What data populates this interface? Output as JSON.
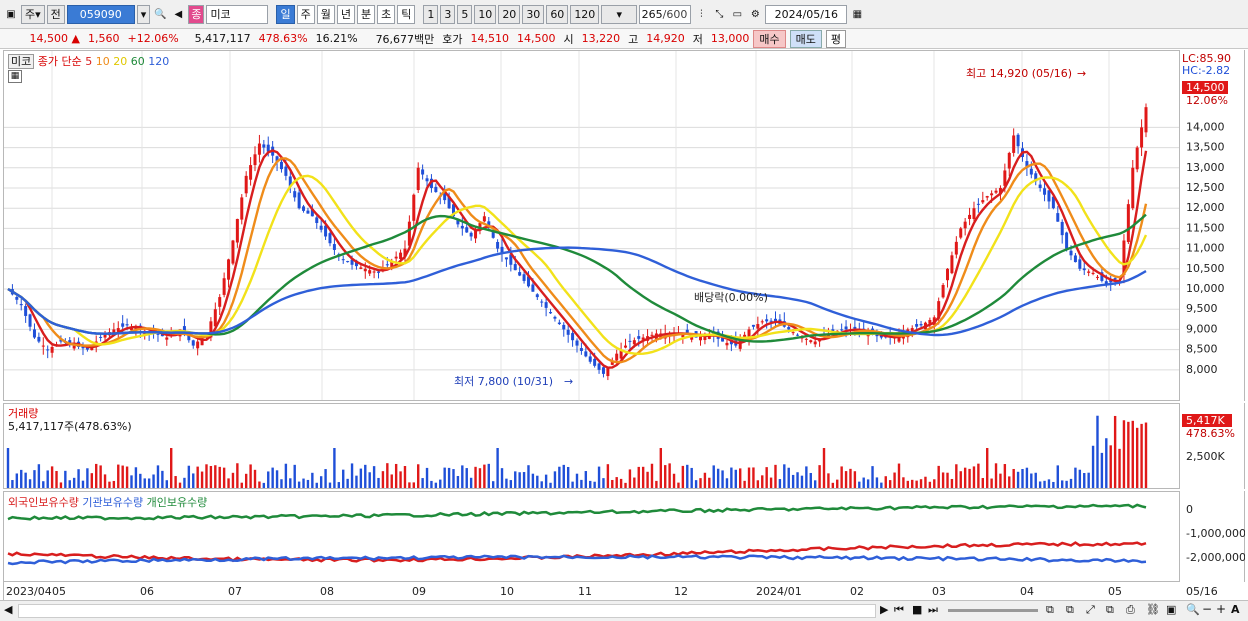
{
  "toolbar": {
    "market_btn": "주",
    "prev_btn": "전",
    "code": "059090",
    "name": "미코",
    "name_badge": "종",
    "periods": [
      "일",
      "주",
      "월",
      "년",
      "분",
      "초",
      "틱"
    ],
    "numbers": [
      "1",
      "3",
      "5",
      "10",
      "20",
      "30",
      "60",
      "120"
    ],
    "count": "265",
    "count_total": "/600",
    "date": "2024/05/16"
  },
  "info": {
    "price": "14,500",
    "change": "1,560",
    "change_pct": "+12.06%",
    "volume": "5,417,117",
    "vol_ratio": "478.63%",
    "turnover": "16.21%",
    "amount": "76,677백만",
    "quote_label": "호가",
    "bid": "14,510",
    "ask": "14,500",
    "open_label": "시",
    "open": "13,220",
    "high_label": "고",
    "high": "14,920",
    "low_label": "저",
    "low": "13,000",
    "buy_btn": "매수",
    "sell_btn": "매도",
    "avg_btn": "평"
  },
  "price_panel": {
    "legend_name": "미코",
    "legend_title": "종가 단순",
    "ma": [
      {
        "label": "5",
        "color": "#d81e1e"
      },
      {
        "label": "10",
        "color": "#ef8c1a"
      },
      {
        "label": "20",
        "color": "#f2e21a"
      },
      {
        "label": "60",
        "color": "#1f8a3a"
      },
      {
        "label": "120",
        "color": "#2f5fd8"
      }
    ],
    "lc": "LC:85.90",
    "hc": "HC:-2.82",
    "last_price": "14,500",
    "last_pct": "12.06%",
    "max_note": "최고 14,920 (05/16)",
    "min_note": "최저 7,800 (10/31)",
    "dividend_note": "배당락(0.00%)",
    "y_ticks": [
      "14,000",
      "13,500",
      "13,000",
      "12,500",
      "12,000",
      "11,500",
      "11,000",
      "10,500",
      "10,000",
      "9,500",
      "9,000",
      "8,500",
      "8,000"
    ]
  },
  "volume_panel": {
    "title": "거래량",
    "value": "5,417,117주(478.63%)",
    "last": "5,417K",
    "last_pct": "478.63%",
    "tick": "2,500K"
  },
  "holdings_panel": {
    "legend": [
      {
        "label": "외국인보유수량",
        "color": "#d81e1e"
      },
      {
        "label": "기관보유수량",
        "color": "#2f5fd8"
      },
      {
        "label": "개인보유수량",
        "color": "#1f8a3a"
      }
    ],
    "ticks": [
      "0",
      "-1,000,000",
      "-2,000,000"
    ]
  },
  "x_axis": {
    "labels": [
      "2023/04",
      "05",
      "06",
      "07",
      "08",
      "09",
      "10",
      "11",
      "12",
      "2024/01",
      "02",
      "03",
      "04",
      "05",
      "05/16"
    ]
  },
  "chart_data": {
    "type": "candlestick",
    "ylim": [
      7800,
      14920
    ],
    "high": {
      "value": 14920,
      "date": "05/16"
    },
    "low": {
      "value": 7800,
      "date": "10/31"
    },
    "close_series": [
      10000,
      9600,
      8800,
      8500,
      8700,
      8600,
      8500,
      8800,
      9000,
      9100,
      9000,
      8900,
      8800,
      9000,
      8600,
      8900,
      9800,
      11200,
      12800,
      13600,
      13300,
      12800,
      12000,
      11800,
      11300,
      10800,
      10600,
      10500,
      10400,
      10700,
      11000,
      13000,
      12500,
      12200,
      11600,
      11300,
      11800,
      11000,
      10600,
      10200,
      9800,
      9400,
      9000,
      8600,
      8200,
      7900,
      8400,
      8700,
      8800,
      8900,
      8900,
      8900,
      8800,
      8900,
      8700,
      8600,
      9000,
      9200,
      9200,
      9000,
      8800,
      8700,
      8900,
      9000,
      9000,
      8900,
      8800,
      8800,
      9000,
      9100,
      9300,
      10500,
      11500,
      12000,
      12300,
      12500,
      13800,
      13000,
      12500,
      12000,
      11000,
      10500,
      10400,
      10100,
      10300,
      13000,
      14500
    ],
    "ma_periods": [
      5,
      10,
      20,
      60,
      120
    ]
  }
}
